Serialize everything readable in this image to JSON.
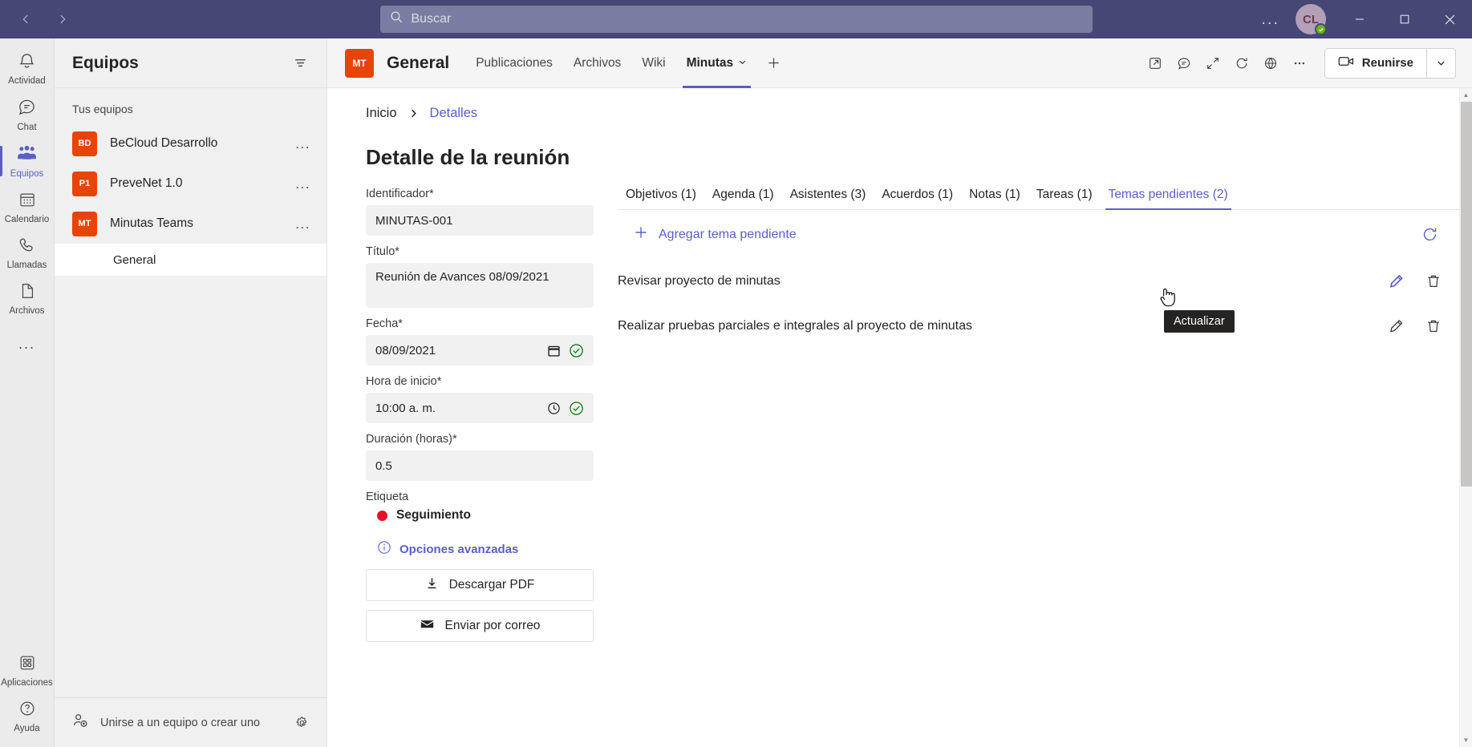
{
  "titlebar": {
    "back_label": "Atrás",
    "forward_label": "Adelante",
    "search_placeholder": "Buscar",
    "more_label": "...",
    "avatar_initials": "CL",
    "minimize_label": "Minimizar",
    "maximize_label": "Maximizar",
    "close_label": "Cerrar"
  },
  "rail": {
    "items": [
      {
        "label": "Actividad",
        "icon": "bell-icon",
        "active": false
      },
      {
        "label": "Chat",
        "icon": "chat-icon",
        "active": false
      },
      {
        "label": "Equipos",
        "icon": "teams-icon",
        "active": true
      },
      {
        "label": "Calendario",
        "icon": "calendar-icon",
        "active": false
      },
      {
        "label": "Llamadas",
        "icon": "phone-icon",
        "active": false
      },
      {
        "label": "Archivos",
        "icon": "file-icon",
        "active": false
      }
    ],
    "more": "...",
    "bottom": [
      {
        "label": "Aplicaciones",
        "icon": "apps-icon"
      },
      {
        "label": "Ayuda",
        "icon": "help-icon"
      }
    ]
  },
  "teams_panel": {
    "title": "Equipos",
    "filter_icon": "filter-icon",
    "section_label": "Tus equipos",
    "teams": [
      {
        "initials": "BD",
        "name": "BeCloud Desarrollo",
        "menu": "..."
      },
      {
        "initials": "P1",
        "name": "PreveNet 1.0",
        "menu": "..."
      },
      {
        "initials": "MT",
        "name": "Minutas Teams",
        "menu": "..."
      }
    ],
    "channels": [
      {
        "name": "General",
        "active": true
      }
    ],
    "join_label": "Unirse a un equipo o crear uno",
    "settings_icon": "gear-icon"
  },
  "channel_header": {
    "badge": "MT",
    "title": "General",
    "tabs": [
      {
        "label": "Publicaciones",
        "active": false,
        "caret": false
      },
      {
        "label": "Archivos",
        "active": false,
        "caret": false
      },
      {
        "label": "Wiki",
        "active": false,
        "caret": false
      },
      {
        "label": "Minutas",
        "active": true,
        "caret": true
      }
    ],
    "add_tab": "+",
    "actions": [
      {
        "icon": "open-in-new-icon",
        "name": "open-in-browser-button"
      },
      {
        "icon": "chat-bubble-icon",
        "name": "conversation-button"
      },
      {
        "icon": "expand-icon",
        "name": "fullscreen-button"
      },
      {
        "icon": "refresh-icon",
        "name": "reload-button"
      },
      {
        "icon": "globe-icon",
        "name": "website-button"
      },
      {
        "icon": "ellipsis-icon",
        "name": "more-options-button"
      }
    ],
    "meet_label": "Reunirse",
    "meet_caret": "chevron-down-icon"
  },
  "breadcrumb": {
    "home": "Inicio",
    "separator": "chevron-right-icon",
    "current": "Detalles"
  },
  "page_title": "Detalle de la reunión",
  "form": {
    "fields": [
      {
        "label": "Identificador*",
        "value": "MINUTAS-001",
        "tall": false,
        "icon": null,
        "valid": false
      },
      {
        "label": "Título*",
        "value": "Reunión  de Avances 08/09/2021",
        "tall": true,
        "icon": null,
        "valid": false
      },
      {
        "label": "Fecha*",
        "value": "08/09/2021",
        "tall": false,
        "icon": "calendar-icon",
        "valid": true
      },
      {
        "label": "Hora de inicio*",
        "value": "10:00  a. m.",
        "tall": false,
        "icon": "clock-icon",
        "valid": true
      },
      {
        "label": "Duración (horas)*",
        "value": "0.5",
        "tall": false,
        "icon": null,
        "valid": false
      }
    ],
    "tag_label": "Etiqueta",
    "tag_value": "Seguimiento",
    "tag_color": "#e81123",
    "advanced_label": "Opciones avanzadas",
    "advanced_icon": "info-icon",
    "buttons": [
      {
        "label": "Descargar PDF",
        "icon": "download-icon"
      },
      {
        "label": "Enviar por correo",
        "icon": "mail-icon"
      }
    ]
  },
  "detail": {
    "tabs": [
      {
        "label": "Objetivos (1)",
        "active": false
      },
      {
        "label": "Agenda (1)",
        "active": false
      },
      {
        "label": "Asistentes (3)",
        "active": false
      },
      {
        "label": "Acuerdos (1)",
        "active": false
      },
      {
        "label": "Notas (1)",
        "active": false
      },
      {
        "label": "Tareas (1)",
        "active": false
      },
      {
        "label": "Temas pendientes (2)",
        "active": true
      }
    ],
    "add_label": "Agregar tema pendiente",
    "add_icon": "plus-icon",
    "refresh_icon": "refresh-icon",
    "topics": [
      {
        "text": "Revisar proyecto de minutas",
        "edit_icon": "pencil-icon",
        "delete_icon": "trash-icon",
        "highlighted": true
      },
      {
        "text": "Realizar pruebas parciales e integrales al proyecto de minutas",
        "edit_icon": "pencil-icon",
        "delete_icon": "trash-icon",
        "highlighted": false
      }
    ]
  },
  "tooltip": {
    "text": "Actualizar"
  },
  "colors": {
    "accent": "#5b5fc7",
    "titlebar": "#464775",
    "team_badge": "#e8440a",
    "success": "#107c10"
  }
}
